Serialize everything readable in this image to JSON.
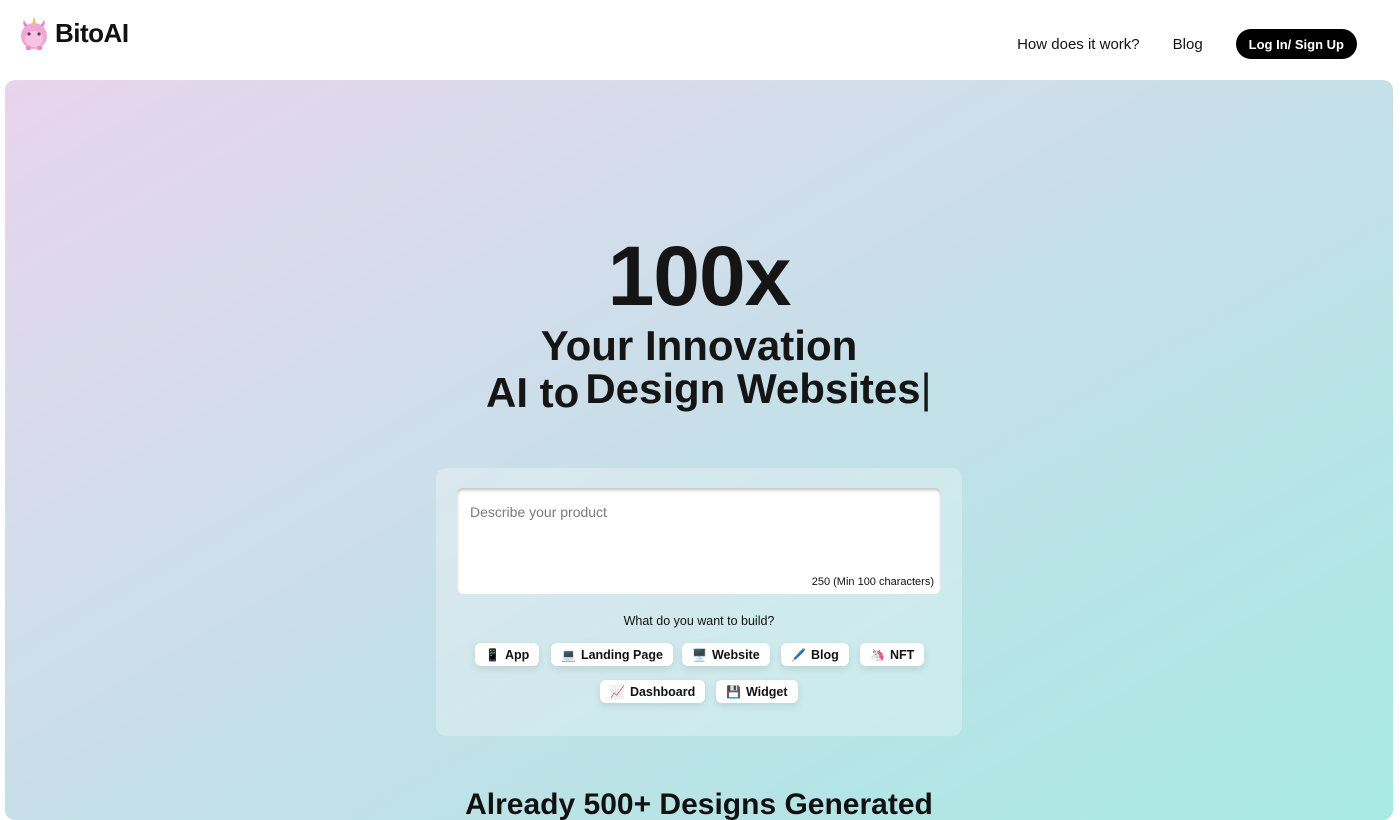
{
  "header": {
    "brand": "BitoAI",
    "nav": {
      "how_it_works": "How does it work?",
      "blog": "Blog"
    },
    "login_label": "Log In/ Sign Up"
  },
  "hero": {
    "headline": "100x",
    "subline_1": "Your Innovation",
    "subline_2_prefix": "AI to",
    "subline_2_text": "Design Websites",
    "cursor": "|"
  },
  "form": {
    "placeholder": "Describe your product",
    "char_count": "250 (Min 100 characters)",
    "question": "What do you want to build?",
    "options": [
      {
        "icon": "📱",
        "label": "App"
      },
      {
        "icon": "💻",
        "label": "Landing Page"
      },
      {
        "icon": "🖥️",
        "label": "Website"
      },
      {
        "icon": "🖊️",
        "label": "Blog"
      },
      {
        "icon": "🦄",
        "label": "NFT"
      },
      {
        "icon": "📈",
        "label": "Dashboard"
      },
      {
        "icon": "💾",
        "label": "Widget"
      }
    ]
  },
  "bottom": {
    "title": "Already 500+ Designs Generated"
  },
  "colors": {
    "accent": "#000000",
    "gradient_start": "#e8d4ec",
    "gradient_end": "#a8eae4"
  }
}
